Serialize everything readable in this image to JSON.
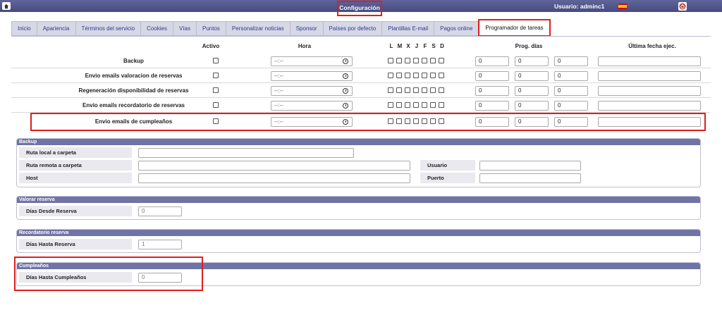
{
  "topbar": {
    "title": "Configuración",
    "user": "Usuario: adminc1",
    "icons": {
      "home": "home-icon",
      "flag": "spain-flag-icon",
      "power": "power-icon"
    }
  },
  "tabs": [
    {
      "label": "Inicio",
      "active": false
    },
    {
      "label": "Apariencia",
      "active": false
    },
    {
      "label": "Términos del servicio",
      "active": false
    },
    {
      "label": "Cookies",
      "active": false
    },
    {
      "label": "Vías",
      "active": false
    },
    {
      "label": "Puntos",
      "active": false
    },
    {
      "label": "Personalizar noticias",
      "active": false
    },
    {
      "label": "Sponsor",
      "active": false
    },
    {
      "label": "Países por defecto",
      "active": false
    },
    {
      "label": "Plantillas E-mail",
      "active": false
    },
    {
      "label": "Pagos online",
      "active": false
    },
    {
      "label": "Programador de tareas",
      "active": true
    }
  ],
  "columns": {
    "activo": "Activo",
    "hora": "Hora",
    "days": [
      "L",
      "M",
      "X",
      "J",
      "F",
      "S",
      "D"
    ],
    "prog": "Prog. días",
    "ultima": "Última fecha ejec."
  },
  "tasks": [
    {
      "label": "Backup",
      "hora": "--:--",
      "prog": [
        "0",
        "0",
        "0"
      ],
      "ultima": ""
    },
    {
      "label": "Envio emails valoracion de reservas",
      "hora": "--:--",
      "prog": [
        "0",
        "0",
        "0"
      ],
      "ultima": ""
    },
    {
      "label": "Regeneración disponibilidad de reservas",
      "hora": "--:--",
      "prog": [
        "0",
        "0",
        "0"
      ],
      "ultima": ""
    },
    {
      "label": "Envio emails recordatorio de reservas",
      "hora": "--:--",
      "prog": [
        "0",
        "0",
        "0"
      ],
      "ultima": ""
    },
    {
      "label": "Envio emails de cumpleaños",
      "hora": "--:--",
      "prog": [
        "0",
        "0",
        "0"
      ],
      "ultima": ""
    }
  ],
  "backup": {
    "title": "Backup",
    "ruta_local": "Ruta local a carpeta",
    "ruta_remota": "Ruta remota a carpeta",
    "host": "Host",
    "usuario": "Usuario",
    "puerto": "Puerto"
  },
  "valorar": {
    "title": "Valorar reserva",
    "label": "Días Desde Reserva",
    "value": "0"
  },
  "recordatorio": {
    "title": "Recordatorio reserva",
    "label": "Días Hasta Reserva",
    "value": "1"
  },
  "cumple": {
    "title": "Cumpleaños",
    "label": "Días Hasta Cumpleaños",
    "value": "0"
  },
  "colors": {
    "header": "#474b80",
    "highlight": "#e11d1d",
    "tab_bg": "#d6d8e6",
    "section_head": "#6f73a6"
  }
}
